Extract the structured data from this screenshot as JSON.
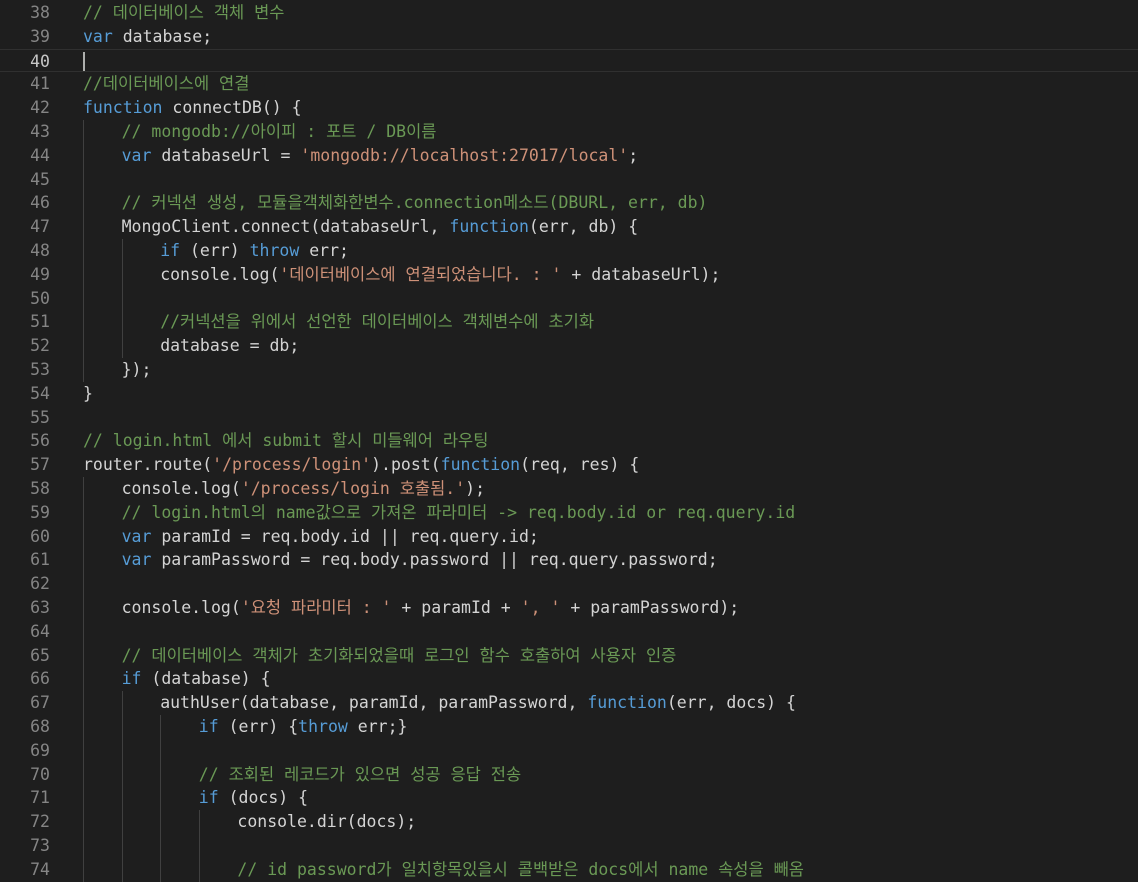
{
  "editor": {
    "current_line": "40",
    "lines": [
      {
        "num": "38",
        "indent": 0,
        "tokens": [
          {
            "t": "cmt",
            "v": "// 데이터베이스 객체 변수"
          }
        ]
      },
      {
        "num": "39",
        "indent": 0,
        "tokens": [
          {
            "t": "kw",
            "v": "var"
          },
          {
            "t": "txt",
            "v": " database;"
          }
        ]
      },
      {
        "num": "40",
        "indent": 0,
        "tokens": []
      },
      {
        "num": "41",
        "indent": 0,
        "tokens": [
          {
            "t": "cmt",
            "v": "//데이터베이스에 연결"
          }
        ]
      },
      {
        "num": "42",
        "indent": 0,
        "tokens": [
          {
            "t": "kw",
            "v": "function"
          },
          {
            "t": "txt",
            "v": " connectDB() {"
          }
        ]
      },
      {
        "num": "43",
        "indent": 1,
        "tokens": [
          {
            "t": "cmt",
            "v": "// mongodb://아이피 : 포트 / DB이름"
          }
        ]
      },
      {
        "num": "44",
        "indent": 1,
        "tokens": [
          {
            "t": "kw",
            "v": "var"
          },
          {
            "t": "txt",
            "v": " databaseUrl = "
          },
          {
            "t": "str",
            "v": "'mongodb://localhost:27017/local'"
          },
          {
            "t": "txt",
            "v": ";"
          }
        ]
      },
      {
        "num": "45",
        "indent": 0,
        "tokens": []
      },
      {
        "num": "46",
        "indent": 1,
        "tokens": [
          {
            "t": "cmt",
            "v": "// 커넥션 생성, 모듈을객체화한변수.connection메소드(DBURL, err, db)"
          }
        ]
      },
      {
        "num": "47",
        "indent": 1,
        "tokens": [
          {
            "t": "txt",
            "v": "MongoClient.connect(databaseUrl, "
          },
          {
            "t": "kw",
            "v": "function"
          },
          {
            "t": "txt",
            "v": "(err, db) {"
          }
        ]
      },
      {
        "num": "48",
        "indent": 2,
        "tokens": [
          {
            "t": "kw",
            "v": "if"
          },
          {
            "t": "txt",
            "v": " (err) "
          },
          {
            "t": "kw",
            "v": "throw"
          },
          {
            "t": "txt",
            "v": " err;"
          }
        ]
      },
      {
        "num": "49",
        "indent": 2,
        "tokens": [
          {
            "t": "txt",
            "v": "console.log("
          },
          {
            "t": "str",
            "v": "'데이터베이스에 연결되었습니다. : '"
          },
          {
            "t": "txt",
            "v": " + databaseUrl);"
          }
        ]
      },
      {
        "num": "50",
        "indent": 0,
        "tokens": []
      },
      {
        "num": "51",
        "indent": 2,
        "tokens": [
          {
            "t": "cmt",
            "v": "//커넥션을 위에서 선언한 데이터베이스 객체변수에 초기화"
          }
        ]
      },
      {
        "num": "52",
        "indent": 2,
        "tokens": [
          {
            "t": "txt",
            "v": "database = db;"
          }
        ]
      },
      {
        "num": "53",
        "indent": 1,
        "tokens": [
          {
            "t": "txt",
            "v": "});"
          }
        ]
      },
      {
        "num": "54",
        "indent": 0,
        "tokens": [
          {
            "t": "txt",
            "v": "}"
          }
        ]
      },
      {
        "num": "55",
        "indent": 0,
        "tokens": []
      },
      {
        "num": "56",
        "indent": 0,
        "tokens": [
          {
            "t": "cmt",
            "v": "// login.html 에서 submit 할시 미들웨어 라우팅"
          }
        ]
      },
      {
        "num": "57",
        "indent": 0,
        "tokens": [
          {
            "t": "txt",
            "v": "router.route("
          },
          {
            "t": "str",
            "v": "'/process/login'"
          },
          {
            "t": "txt",
            "v": ").post("
          },
          {
            "t": "kw",
            "v": "function"
          },
          {
            "t": "txt",
            "v": "(req, res) {"
          }
        ]
      },
      {
        "num": "58",
        "indent": 1,
        "tokens": [
          {
            "t": "txt",
            "v": "console.log("
          },
          {
            "t": "str",
            "v": "'/process/login 호출됨.'"
          },
          {
            "t": "txt",
            "v": ");"
          }
        ]
      },
      {
        "num": "59",
        "indent": 1,
        "tokens": [
          {
            "t": "cmt",
            "v": "// login.html의 name값으로 가져온 파라미터 -> req.body.id or req.query.id"
          }
        ]
      },
      {
        "num": "60",
        "indent": 1,
        "tokens": [
          {
            "t": "kw",
            "v": "var"
          },
          {
            "t": "txt",
            "v": " paramId = req.body.id || req.query.id;"
          }
        ]
      },
      {
        "num": "61",
        "indent": 1,
        "tokens": [
          {
            "t": "kw",
            "v": "var"
          },
          {
            "t": "txt",
            "v": " paramPassword = req.body.password || req.query.password;"
          }
        ]
      },
      {
        "num": "62",
        "indent": 0,
        "tokens": []
      },
      {
        "num": "63",
        "indent": 1,
        "tokens": [
          {
            "t": "txt",
            "v": "console.log("
          },
          {
            "t": "str",
            "v": "'요청 파라미터 : '"
          },
          {
            "t": "txt",
            "v": " + paramId + "
          },
          {
            "t": "str",
            "v": "', '"
          },
          {
            "t": "txt",
            "v": " + paramPassword);"
          }
        ]
      },
      {
        "num": "64",
        "indent": 0,
        "tokens": []
      },
      {
        "num": "65",
        "indent": 1,
        "tokens": [
          {
            "t": "cmt",
            "v": "// 데이터베이스 객체가 초기화되었을때 로그인 함수 호출하여 사용자 인증"
          }
        ]
      },
      {
        "num": "66",
        "indent": 1,
        "tokens": [
          {
            "t": "kw",
            "v": "if"
          },
          {
            "t": "txt",
            "v": " (database) {"
          }
        ]
      },
      {
        "num": "67",
        "indent": 2,
        "tokens": [
          {
            "t": "txt",
            "v": "authUser(database, paramId, paramPassword, "
          },
          {
            "t": "kw",
            "v": "function"
          },
          {
            "t": "txt",
            "v": "(err, docs) {"
          }
        ]
      },
      {
        "num": "68",
        "indent": 3,
        "tokens": [
          {
            "t": "kw",
            "v": "if"
          },
          {
            "t": "txt",
            "v": " (err) {"
          },
          {
            "t": "kw",
            "v": "throw"
          },
          {
            "t": "txt",
            "v": " err;}"
          }
        ]
      },
      {
        "num": "69",
        "indent": 0,
        "tokens": []
      },
      {
        "num": "70",
        "indent": 3,
        "tokens": [
          {
            "t": "cmt",
            "v": "// 조회된 레코드가 있으면 성공 응답 전송"
          }
        ]
      },
      {
        "num": "71",
        "indent": 3,
        "tokens": [
          {
            "t": "kw",
            "v": "if"
          },
          {
            "t": "txt",
            "v": " (docs) {"
          }
        ]
      },
      {
        "num": "72",
        "indent": 4,
        "tokens": [
          {
            "t": "txt",
            "v": "console.dir(docs);"
          }
        ]
      },
      {
        "num": "73",
        "indent": 0,
        "tokens": []
      },
      {
        "num": "74",
        "indent": 4,
        "tokens": [
          {
            "t": "cmt",
            "v": "// id password가 일치항목있을시 콜백받은 docs에서 name 속성을 빼옴"
          }
        ]
      }
    ]
  }
}
